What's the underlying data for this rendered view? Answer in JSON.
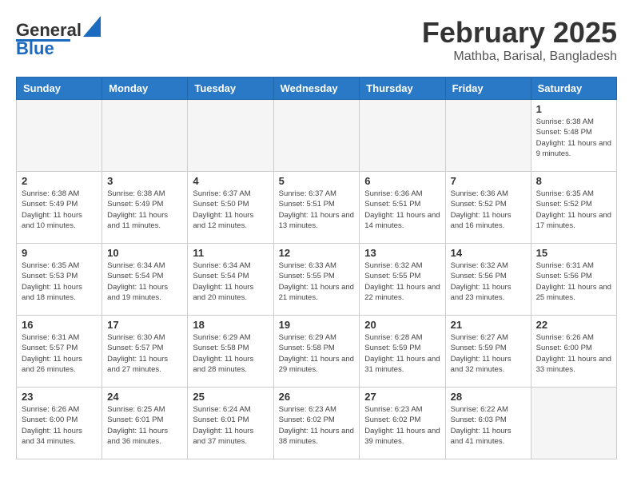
{
  "logo": {
    "text_general": "General",
    "text_blue": "Blue"
  },
  "title": "February 2025",
  "subtitle": "Mathba, Barisal, Bangladesh",
  "days_of_week": [
    "Sunday",
    "Monday",
    "Tuesday",
    "Wednesday",
    "Thursday",
    "Friday",
    "Saturday"
  ],
  "weeks": [
    [
      {
        "day": "",
        "info": ""
      },
      {
        "day": "",
        "info": ""
      },
      {
        "day": "",
        "info": ""
      },
      {
        "day": "",
        "info": ""
      },
      {
        "day": "",
        "info": ""
      },
      {
        "day": "",
        "info": ""
      },
      {
        "day": "1",
        "info": "Sunrise: 6:38 AM\nSunset: 5:48 PM\nDaylight: 11 hours and 9 minutes."
      }
    ],
    [
      {
        "day": "2",
        "info": "Sunrise: 6:38 AM\nSunset: 5:49 PM\nDaylight: 11 hours and 10 minutes."
      },
      {
        "day": "3",
        "info": "Sunrise: 6:38 AM\nSunset: 5:49 PM\nDaylight: 11 hours and 11 minutes."
      },
      {
        "day": "4",
        "info": "Sunrise: 6:37 AM\nSunset: 5:50 PM\nDaylight: 11 hours and 12 minutes."
      },
      {
        "day": "5",
        "info": "Sunrise: 6:37 AM\nSunset: 5:51 PM\nDaylight: 11 hours and 13 minutes."
      },
      {
        "day": "6",
        "info": "Sunrise: 6:36 AM\nSunset: 5:51 PM\nDaylight: 11 hours and 14 minutes."
      },
      {
        "day": "7",
        "info": "Sunrise: 6:36 AM\nSunset: 5:52 PM\nDaylight: 11 hours and 16 minutes."
      },
      {
        "day": "8",
        "info": "Sunrise: 6:35 AM\nSunset: 5:52 PM\nDaylight: 11 hours and 17 minutes."
      }
    ],
    [
      {
        "day": "9",
        "info": "Sunrise: 6:35 AM\nSunset: 5:53 PM\nDaylight: 11 hours and 18 minutes."
      },
      {
        "day": "10",
        "info": "Sunrise: 6:34 AM\nSunset: 5:54 PM\nDaylight: 11 hours and 19 minutes."
      },
      {
        "day": "11",
        "info": "Sunrise: 6:34 AM\nSunset: 5:54 PM\nDaylight: 11 hours and 20 minutes."
      },
      {
        "day": "12",
        "info": "Sunrise: 6:33 AM\nSunset: 5:55 PM\nDaylight: 11 hours and 21 minutes."
      },
      {
        "day": "13",
        "info": "Sunrise: 6:32 AM\nSunset: 5:55 PM\nDaylight: 11 hours and 22 minutes."
      },
      {
        "day": "14",
        "info": "Sunrise: 6:32 AM\nSunset: 5:56 PM\nDaylight: 11 hours and 23 minutes."
      },
      {
        "day": "15",
        "info": "Sunrise: 6:31 AM\nSunset: 5:56 PM\nDaylight: 11 hours and 25 minutes."
      }
    ],
    [
      {
        "day": "16",
        "info": "Sunrise: 6:31 AM\nSunset: 5:57 PM\nDaylight: 11 hours and 26 minutes."
      },
      {
        "day": "17",
        "info": "Sunrise: 6:30 AM\nSunset: 5:57 PM\nDaylight: 11 hours and 27 minutes."
      },
      {
        "day": "18",
        "info": "Sunrise: 6:29 AM\nSunset: 5:58 PM\nDaylight: 11 hours and 28 minutes."
      },
      {
        "day": "19",
        "info": "Sunrise: 6:29 AM\nSunset: 5:58 PM\nDaylight: 11 hours and 29 minutes."
      },
      {
        "day": "20",
        "info": "Sunrise: 6:28 AM\nSunset: 5:59 PM\nDaylight: 11 hours and 31 minutes."
      },
      {
        "day": "21",
        "info": "Sunrise: 6:27 AM\nSunset: 5:59 PM\nDaylight: 11 hours and 32 minutes."
      },
      {
        "day": "22",
        "info": "Sunrise: 6:26 AM\nSunset: 6:00 PM\nDaylight: 11 hours and 33 minutes."
      }
    ],
    [
      {
        "day": "23",
        "info": "Sunrise: 6:26 AM\nSunset: 6:00 PM\nDaylight: 11 hours and 34 minutes."
      },
      {
        "day": "24",
        "info": "Sunrise: 6:25 AM\nSunset: 6:01 PM\nDaylight: 11 hours and 36 minutes."
      },
      {
        "day": "25",
        "info": "Sunrise: 6:24 AM\nSunset: 6:01 PM\nDaylight: 11 hours and 37 minutes."
      },
      {
        "day": "26",
        "info": "Sunrise: 6:23 AM\nSunset: 6:02 PM\nDaylight: 11 hours and 38 minutes."
      },
      {
        "day": "27",
        "info": "Sunrise: 6:23 AM\nSunset: 6:02 PM\nDaylight: 11 hours and 39 minutes."
      },
      {
        "day": "28",
        "info": "Sunrise: 6:22 AM\nSunset: 6:03 PM\nDaylight: 11 hours and 41 minutes."
      },
      {
        "day": "",
        "info": ""
      }
    ]
  ]
}
